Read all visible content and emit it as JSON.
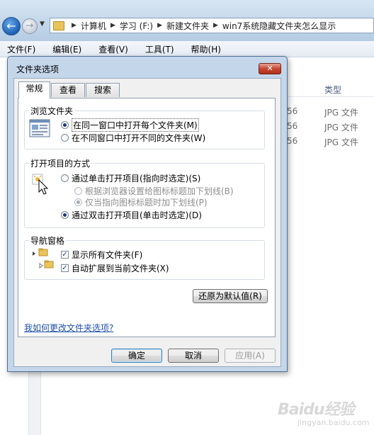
{
  "explorer": {
    "breadcrumbs": [
      "计算机",
      "学习 (F:)",
      "新建文件夹",
      "win7系统隐藏文件夹怎么显示"
    ],
    "menu": [
      "文件(F)",
      "编辑(E)",
      "查看(V)",
      "工具(T)",
      "帮助(H)"
    ],
    "column_type": "类型",
    "rows": [
      {
        "date_fragment": "56",
        "type": "JPG 文件"
      },
      {
        "date_fragment": "56",
        "type": "JPG 文件"
      },
      {
        "date_fragment": "56",
        "type": "JPG 文件"
      }
    ]
  },
  "dialog": {
    "title": "文件夹选项",
    "close_label": "✕",
    "tabs": [
      "常规",
      "查看",
      "搜索"
    ],
    "browse": {
      "title": "浏览文件夹",
      "option_same": "在同一窗口中打开每个文件夹(M)",
      "option_new": "在不同窗口中打开不同的文件夹(W)"
    },
    "open_items": {
      "title": "打开项目的方式",
      "option_single": "通过单击打开项目(指向时选定)(S)",
      "sub_browser": "根据浏览器设置给图标标题加下划线(B)",
      "sub_point": "仅当指向图标标题时加下划线(P)",
      "option_double": "通过双击打开项目(单击时选定)(D)"
    },
    "nav_pane": {
      "title": "导航窗格",
      "show_all": "显示所有文件夹(F)",
      "auto_expand": "自动扩展到当前文件夹(X)"
    },
    "restore_button": "还原为默认值(R)",
    "help_link": "我如何更改文件夹选项?",
    "ok_button": "确定",
    "cancel_button": "取消",
    "apply_button": "应用(A)"
  },
  "watermark": {
    "brand": "Baidu经验",
    "sub": "jingyan.baidu.com"
  }
}
